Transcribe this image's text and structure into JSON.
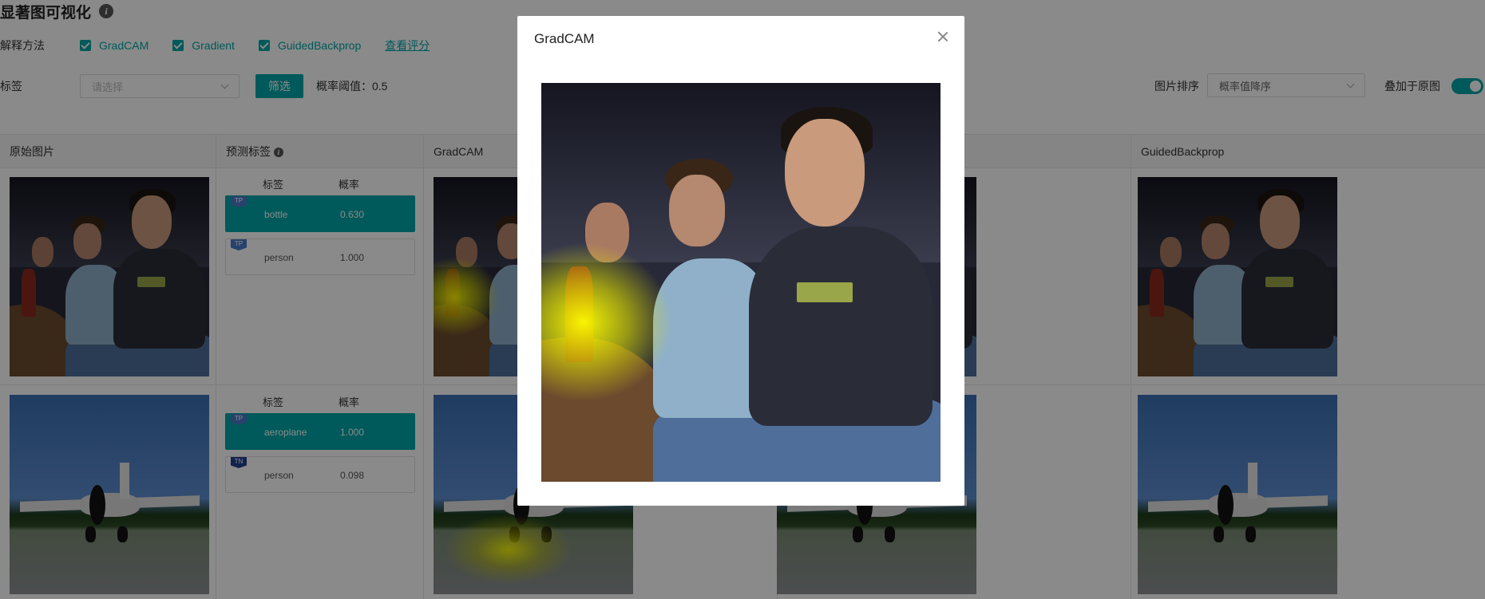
{
  "page": {
    "title": "显著图可视化",
    "info_icon": "i"
  },
  "methods": {
    "label": "解释方法",
    "options": [
      {
        "label": "GradCAM",
        "checked": true
      },
      {
        "label": "Gradient",
        "checked": true
      },
      {
        "label": "GuidedBackprop",
        "checked": true
      }
    ],
    "view_score_link": "查看评分"
  },
  "filter": {
    "label": "标签",
    "select_placeholder": "请选择",
    "filter_button": "筛选",
    "threshold_text": "概率阈值：0.5",
    "sort_label": "图片排序",
    "sort_value": "概率值降序",
    "overlay_label": "叠加于原图",
    "overlay_on": true
  },
  "table": {
    "columns": [
      "原始图片",
      "预测标签",
      "GradCAM",
      "GuidedBackprop"
    ],
    "pred_headers": [
      "标签",
      "概率"
    ],
    "rows": [
      {
        "predictions": [
          {
            "tag": "TP",
            "label": "bottle",
            "prob": "0.630",
            "selected": true
          },
          {
            "tag": "TP",
            "label": "person",
            "prob": "1.000",
            "selected": false
          }
        ]
      },
      {
        "predictions": [
          {
            "tag": "TP",
            "label": "aeroplane",
            "prob": "1.000",
            "selected": true
          },
          {
            "tag": "TN",
            "label": "person",
            "prob": "0.098",
            "selected": false
          }
        ]
      }
    ]
  },
  "modal": {
    "title": "GradCAM",
    "close_icon": "close-icon"
  },
  "colors": {
    "accent": "#00a5a7",
    "tag_tp": "#4a7bc9",
    "tag_tn": "#24408e",
    "overlay": "rgba(0,0,0,0.46)"
  }
}
